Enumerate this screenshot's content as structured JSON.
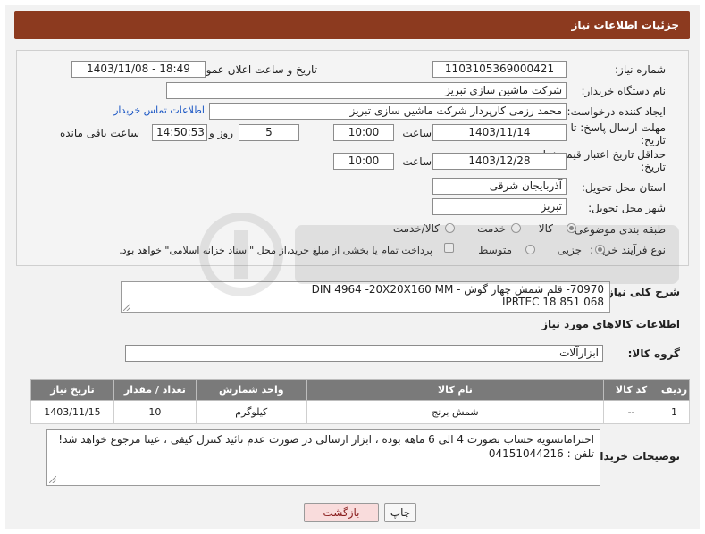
{
  "header": {
    "title": "جزئیات اطلاعات نیاز"
  },
  "form": {
    "need_number": {
      "label": "شماره نیاز:",
      "value": "1103105369000421"
    },
    "announce": {
      "label": "تاریخ و ساعت اعلان عمومی:",
      "value": "1403/11/08 - 18:49"
    },
    "buyer_org": {
      "label": "نام دستگاه خریدار:",
      "value": "شرکت ماشین سازی تبریز"
    },
    "requester": {
      "label": "ایجاد کننده درخواست:",
      "value": "محمد رزمی کارپرداز شرکت ماشین سازی تبریز",
      "contact_link": "اطلاعات تماس خریدار"
    },
    "reply_deadline": {
      "label_line1": "مهلت ارسال پاسخ: تا",
      "label_line2": "تاریخ:",
      "date": "1403/11/14",
      "time_label": "ساعت",
      "time": "10:00",
      "days": "5",
      "days_label": "روز و",
      "remaining": "14:50:53",
      "remaining_label": "ساعت باقی مانده"
    },
    "price_validity": {
      "label_line1": "حداقل تاریخ اعتبار قیمت: تا",
      "label_line2": "تاریخ:",
      "date": "1403/12/28",
      "time_label": "ساعت",
      "time": "10:00"
    },
    "province": {
      "label": "استان محل تحویل:",
      "value": "آذربایجان شرقی"
    },
    "city": {
      "label": "شهر محل تحویل:",
      "value": "تبریز"
    },
    "category": {
      "label": "طبقه بندی موضوعی:",
      "options": [
        "کالا",
        "خدمت",
        "کالا/خدمت"
      ],
      "selected": "کالا"
    },
    "purchase_type": {
      "label": "نوع فرآیند خرید :",
      "options": [
        "جزیی",
        "متوسط"
      ],
      "selected": "جزیی",
      "payment_note": "پرداخت تمام یا بخشی از مبلغ خرید،از محل \"اسناد خزانه اسلامی\" خواهد بود."
    }
  },
  "summary": {
    "label": "شرح کلی نیاز:",
    "line1": "70970- قلم شمش چهار گوش -  DIN 4964 -20X20X160 MM",
    "line2": "IPRTEC    18 851 068"
  },
  "goods_section": {
    "title": "اطلاعات کالاهای مورد نیاز",
    "group_label": "گروه کالا:",
    "group_value": "ابزارآلات"
  },
  "table": {
    "headers": [
      "ردیف",
      "کد کالا",
      "نام کالا",
      "واحد شمارش",
      "تعداد / مقدار",
      "تاریخ نیاز"
    ],
    "rows": [
      [
        "1",
        "--",
        "شمش برنج",
        "کیلوگرم",
        "10",
        "1403/11/15"
      ]
    ]
  },
  "notes": {
    "label": "توضیحات خریدار:",
    "text": "احتراماتسویه حساب بصورت 4 الی 6 ماهه بوده ، ابزار ارسالی در صورت عدم تائید کنترل کیفی ، عینا مرجوع خواهد شد! تلفن : 04151044216"
  },
  "buttons": {
    "print": "چاپ",
    "back": "بازگشت"
  }
}
